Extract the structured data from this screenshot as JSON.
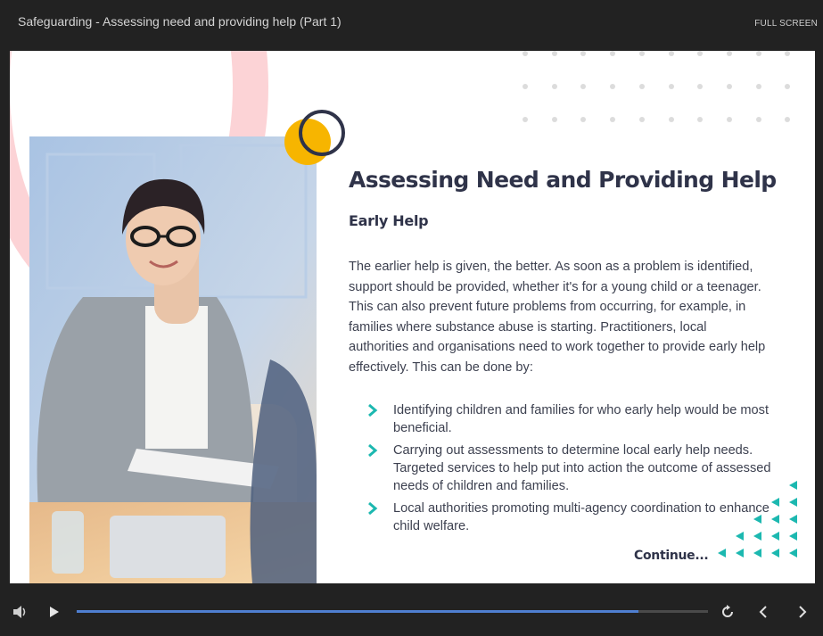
{
  "header": {
    "title": "Safeguarding - Assessing need and providing help (Part 1)",
    "fullscreen_label": "FULL SCREEN"
  },
  "slide": {
    "heading": "Assessing Need and Providing Help",
    "subheading": "Early Help",
    "paragraph": "The earlier help is given, the better. As soon as a problem is identified, support should be provided, whether it's for a young child or a teenager. This can also prevent future problems from occurring, for example, in families where substance abuse is starting. Practitioners, local authorities and organisations need to work together to provide early help effectively. This can be done by:",
    "bullets": [
      "Identifying children and families for who early help would be most beneficial.",
      "Carrying out assessments to determine local early help needs. Targeted services to help put into action the outcome of assessed needs of children and families.",
      "Local authorities promoting multi-agency coordination to enhance child welfare."
    ],
    "continue_label": "Continue..."
  },
  "player": {
    "progress_fraction": 0.89,
    "icons": [
      "volume-icon",
      "play-icon",
      "replay-icon",
      "previous-icon",
      "next-icon"
    ]
  },
  "colors": {
    "accent_teal": "#1cb8b0",
    "accent_yellow": "#f7b500",
    "accent_pink": "#fcd3d6",
    "heading_navy": "#2f3349",
    "progress_blue": "#4f7fd1"
  }
}
